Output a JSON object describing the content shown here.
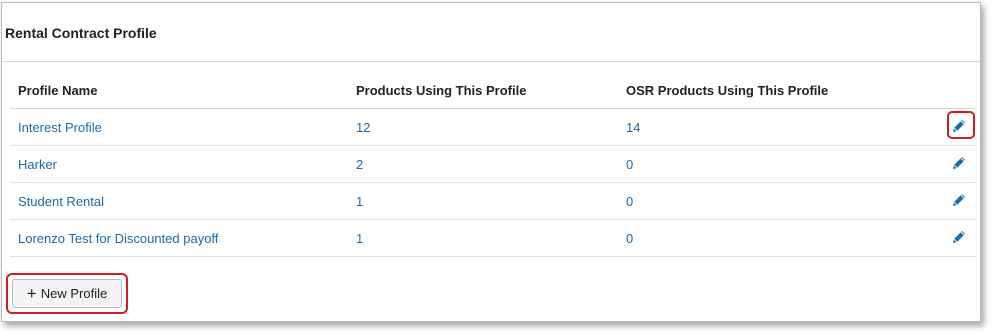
{
  "panel": {
    "title": "Rental Contract Profile"
  },
  "table": {
    "headers": [
      "Profile Name",
      "Products Using This Profile",
      "OSR Products Using This Profile"
    ],
    "rows": [
      {
        "name": "Interest Profile",
        "products": "12",
        "osr": "14"
      },
      {
        "name": "Harker",
        "products": "2",
        "osr": "0"
      },
      {
        "name": "Student Rental",
        "products": "1",
        "osr": "0"
      },
      {
        "name": "Lorenzo Test for Discounted payoff",
        "products": "1",
        "osr": "0"
      }
    ]
  },
  "actions": {
    "new_profile_plus": "+",
    "new_profile_label": "New Profile",
    "edit_icon": "pencil-icon"
  },
  "colors": {
    "link": "#1f6aa8",
    "highlight": "#d01e1e",
    "icon": "#1f6aa8"
  }
}
